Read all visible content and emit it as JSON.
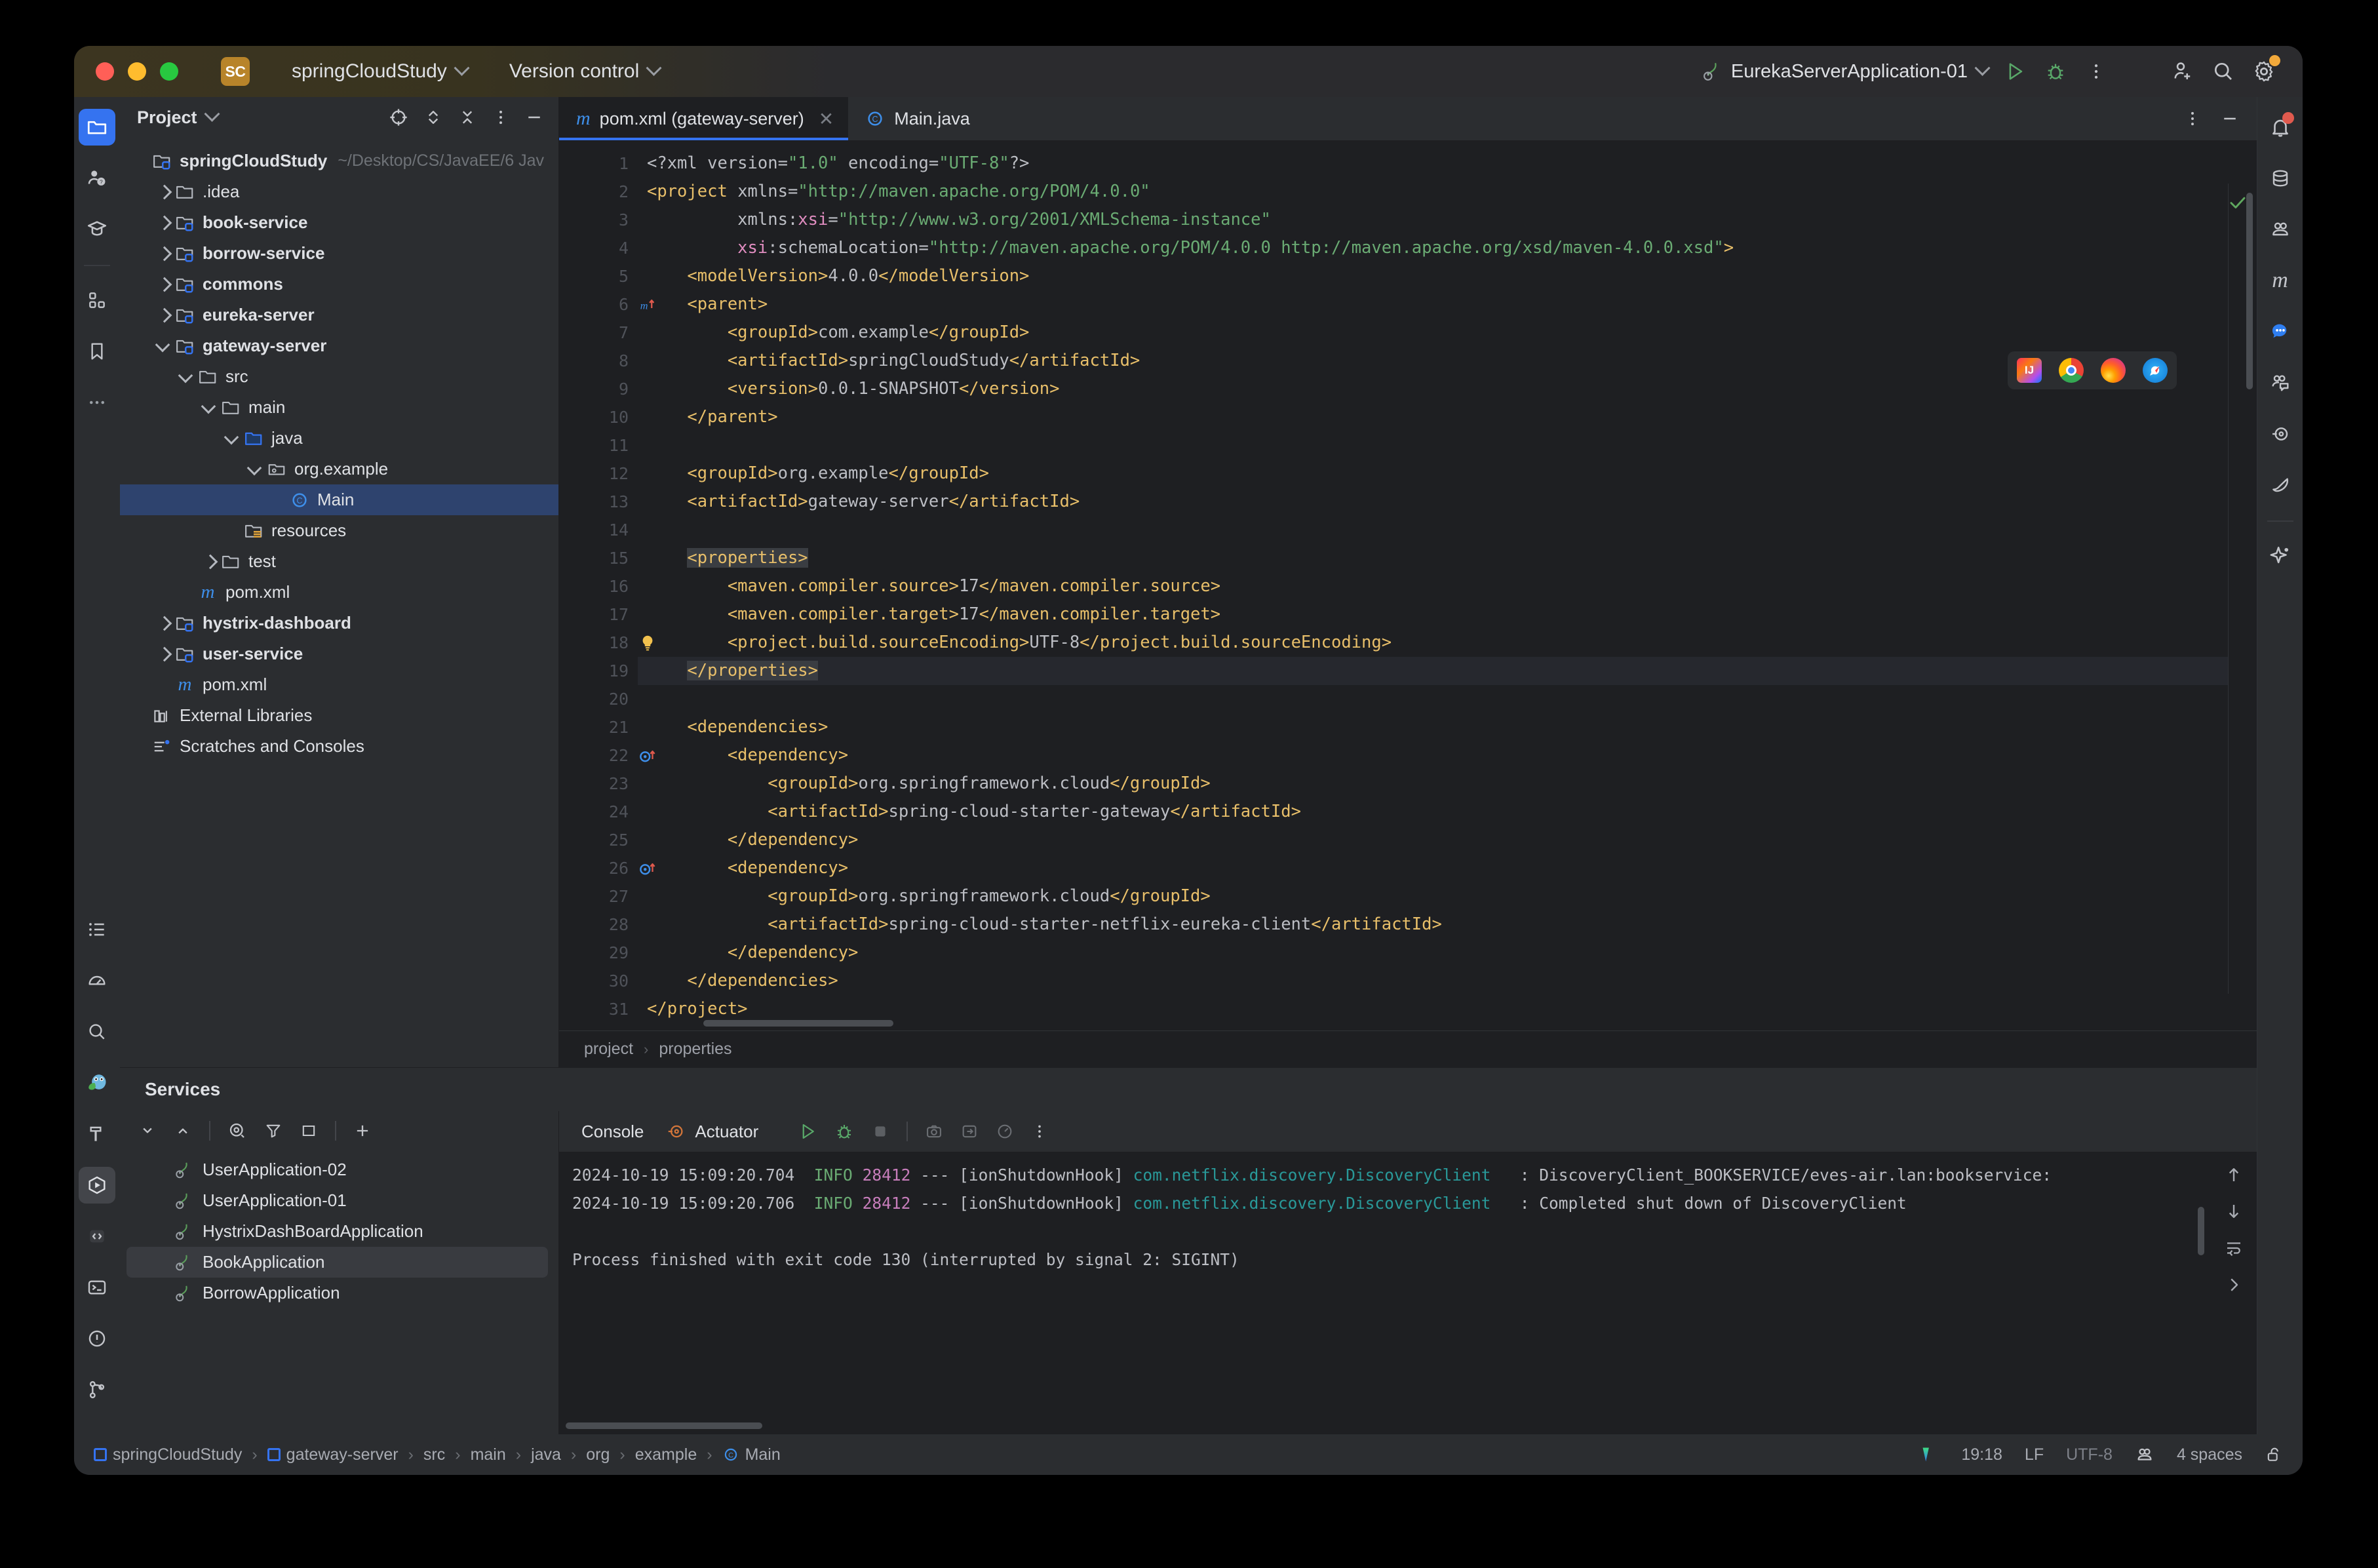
{
  "window": {
    "project_badge": "SC",
    "project_name": "springCloudStudy",
    "version_control": "Version control",
    "run_config": "EurekaServerApplication-01"
  },
  "project_panel": {
    "title": "Project",
    "tree": [
      {
        "label": "springCloudStudy",
        "sub": "~/Desktop/CS/JavaEE/6 Jav",
        "depth": 0,
        "arrow": "none",
        "icon": "module-folder",
        "bold": true,
        "selected": false
      },
      {
        "label": ".idea",
        "sub": "",
        "depth": 1,
        "arrow": "closed",
        "icon": "folder",
        "bold": false,
        "selected": false
      },
      {
        "label": "book-service",
        "sub": "",
        "depth": 1,
        "arrow": "closed",
        "icon": "module-folder",
        "bold": true,
        "selected": false
      },
      {
        "label": "borrow-service",
        "sub": "",
        "depth": 1,
        "arrow": "closed",
        "icon": "module-folder",
        "bold": true,
        "selected": false
      },
      {
        "label": "commons",
        "sub": "",
        "depth": 1,
        "arrow": "closed",
        "icon": "module-folder",
        "bold": true,
        "selected": false
      },
      {
        "label": "eureka-server",
        "sub": "",
        "depth": 1,
        "arrow": "closed",
        "icon": "module-folder",
        "bold": true,
        "selected": false
      },
      {
        "label": "gateway-server",
        "sub": "",
        "depth": 1,
        "arrow": "open",
        "icon": "module-folder",
        "bold": true,
        "selected": false
      },
      {
        "label": "src",
        "sub": "",
        "depth": 2,
        "arrow": "open",
        "icon": "folder",
        "bold": false,
        "selected": false
      },
      {
        "label": "main",
        "sub": "",
        "depth": 3,
        "arrow": "open",
        "icon": "folder",
        "bold": false,
        "selected": false
      },
      {
        "label": "java",
        "sub": "",
        "depth": 4,
        "arrow": "open",
        "icon": "source-folder",
        "bold": false,
        "selected": false
      },
      {
        "label": "org.example",
        "sub": "",
        "depth": 5,
        "arrow": "open",
        "icon": "package",
        "bold": false,
        "selected": false
      },
      {
        "label": "Main",
        "sub": "",
        "depth": 6,
        "arrow": "none",
        "icon": "java-class",
        "bold": false,
        "selected": true
      },
      {
        "label": "resources",
        "sub": "",
        "depth": 4,
        "arrow": "none",
        "icon": "resources-folder",
        "bold": false,
        "selected": false
      },
      {
        "label": "test",
        "sub": "",
        "depth": 3,
        "arrow": "closed",
        "icon": "folder",
        "bold": false,
        "selected": false
      },
      {
        "label": "pom.xml",
        "sub": "",
        "depth": 2,
        "arrow": "none",
        "icon": "maven",
        "bold": false,
        "selected": false
      },
      {
        "label": "hystrix-dashboard",
        "sub": "",
        "depth": 1,
        "arrow": "closed",
        "icon": "module-folder",
        "bold": true,
        "selected": false
      },
      {
        "label": "user-service",
        "sub": "",
        "depth": 1,
        "arrow": "closed",
        "icon": "module-folder",
        "bold": true,
        "selected": false
      },
      {
        "label": "pom.xml",
        "sub": "",
        "depth": 1,
        "arrow": "none",
        "icon": "maven",
        "bold": false,
        "selected": false
      },
      {
        "label": "External Libraries",
        "sub": "",
        "depth": 0,
        "arrow": "none",
        "icon": "libraries",
        "bold": false,
        "selected": false
      },
      {
        "label": "Scratches and Consoles",
        "sub": "",
        "depth": 0,
        "arrow": "none",
        "icon": "scratches",
        "bold": false,
        "selected": false
      }
    ]
  },
  "editor": {
    "tabs": [
      {
        "label": "pom.xml (gateway-server)",
        "icon": "maven-icon",
        "active": true,
        "closable": true
      },
      {
        "label": "Main.java",
        "icon": "java-class-icon",
        "active": false,
        "closable": false
      }
    ],
    "breadcrumb": [
      "project",
      "properties"
    ],
    "current_line": 19,
    "lines": [
      {
        "n": 1,
        "mark": "",
        "cur": false,
        "html": "<span class='pi'>&lt;?xml version=</span><span class='str'>\"1.0\"</span><span class='pi'> encoding=</span><span class='str'>\"UTF-8\"</span><span class='pi'>?&gt;</span>"
      },
      {
        "n": 2,
        "mark": "",
        "cur": false,
        "html": "<span class='tag'>&lt;project</span> <span class='attr'>xmlns=</span><span class='str'>\"http://maven.apache.org/POM/4.0.0\"</span>"
      },
      {
        "n": 3,
        "mark": "",
        "cur": false,
        "html": "         <span class='attr'>xmlns:</span><span class='attrns'>xsi</span><span class='attr'>=</span><span class='str'>\"http://www.w3.org/2001/XMLSchema-instance\"</span>"
      },
      {
        "n": 4,
        "mark": "",
        "cur": false,
        "html": "         <span class='attrns'>xsi</span><span class='attr'>:schemaLocation=</span><span class='str'>\"http://maven.apache.org/POM/4.0.0 http://maven.apache.org/xsd/maven-4.0.0.xsd\"</span><span class='tag'>&gt;</span>"
      },
      {
        "n": 5,
        "mark": "",
        "cur": false,
        "html": "    <span class='tag'>&lt;modelVersion&gt;</span><span class='txt'>4.0.0</span><span class='tag'>&lt;/modelVersion&gt;</span>"
      },
      {
        "n": 6,
        "mark": "maven-parent",
        "cur": false,
        "html": "    <span class='tag'>&lt;parent&gt;</span>"
      },
      {
        "n": 7,
        "mark": "",
        "cur": false,
        "html": "        <span class='tag'>&lt;groupId&gt;</span><span class='txt'>com.example</span><span class='tag'>&lt;/groupId&gt;</span>"
      },
      {
        "n": 8,
        "mark": "",
        "cur": false,
        "html": "        <span class='tag'>&lt;artifactId&gt;</span><span class='txt'>springCloudStudy</span><span class='tag'>&lt;/artifactId&gt;</span>"
      },
      {
        "n": 9,
        "mark": "",
        "cur": false,
        "html": "        <span class='tag'>&lt;version&gt;</span><span class='txt'>0.0.1-SNAPSHOT</span><span class='tag'>&lt;/version&gt;</span>"
      },
      {
        "n": 10,
        "mark": "",
        "cur": false,
        "html": "    <span class='tag'>&lt;/parent&gt;</span>"
      },
      {
        "n": 11,
        "mark": "",
        "cur": false,
        "html": ""
      },
      {
        "n": 12,
        "mark": "",
        "cur": false,
        "html": "    <span class='tag'>&lt;groupId&gt;</span><span class='txt'>org.example</span><span class='tag'>&lt;/groupId&gt;</span>"
      },
      {
        "n": 13,
        "mark": "",
        "cur": false,
        "html": "    <span class='tag'>&lt;artifactId&gt;</span><span class='txt'>gateway-server</span><span class='tag'>&lt;/artifactId&gt;</span>"
      },
      {
        "n": 14,
        "mark": "",
        "cur": false,
        "html": ""
      },
      {
        "n": 15,
        "mark": "",
        "cur": false,
        "html": "    <span class='tag hl'>&lt;properties&gt;</span>"
      },
      {
        "n": 16,
        "mark": "",
        "cur": false,
        "html": "        <span class='tag'>&lt;maven.compiler.source&gt;</span><span class='txt'>17</span><span class='tag'>&lt;/maven.compiler.source&gt;</span>"
      },
      {
        "n": 17,
        "mark": "",
        "cur": false,
        "html": "        <span class='tag'>&lt;maven.compiler.target&gt;</span><span class='txt'>17</span><span class='tag'>&lt;/maven.compiler.target&gt;</span>"
      },
      {
        "n": 18,
        "mark": "bulb",
        "cur": false,
        "html": "        <span class='tag'>&lt;project.build.sourceEncoding&gt;</span><span class='txt'>UTF-8</span><span class='tag'>&lt;/project.build.sourceEncoding&gt;</span>"
      },
      {
        "n": 19,
        "mark": "",
        "cur": true,
        "html": "    <span class='tag hl'>&lt;/properties&gt;</span>"
      },
      {
        "n": 20,
        "mark": "",
        "cur": false,
        "html": ""
      },
      {
        "n": 21,
        "mark": "",
        "cur": false,
        "html": "    <span class='tag'>&lt;dependencies&gt;</span>"
      },
      {
        "n": 22,
        "mark": "maven-dep",
        "cur": false,
        "html": "        <span class='tag'>&lt;dependency&gt;</span>"
      },
      {
        "n": 23,
        "mark": "",
        "cur": false,
        "html": "            <span class='tag'>&lt;groupId&gt;</span><span class='txt'>org.springframework.cloud</span><span class='tag'>&lt;/groupId&gt;</span>"
      },
      {
        "n": 24,
        "mark": "",
        "cur": false,
        "html": "            <span class='tag'>&lt;artifactId&gt;</span><span class='txt'>spring-cloud-starter-gateway</span><span class='tag'>&lt;/artifactId&gt;</span>"
      },
      {
        "n": 25,
        "mark": "",
        "cur": false,
        "html": "        <span class='tag'>&lt;/dependency&gt;</span>"
      },
      {
        "n": 26,
        "mark": "maven-dep",
        "cur": false,
        "html": "        <span class='tag'>&lt;dependency&gt;</span>"
      },
      {
        "n": 27,
        "mark": "",
        "cur": false,
        "html": "            <span class='tag'>&lt;groupId&gt;</span><span class='txt'>org.springframework.cloud</span><span class='tag'>&lt;/groupId&gt;</span>"
      },
      {
        "n": 28,
        "mark": "",
        "cur": false,
        "html": "            <span class='tag'>&lt;artifactId&gt;</span><span class='txt'>spring-cloud-starter-netflix-eureka-client</span><span class='tag'>&lt;/artifactId&gt;</span>"
      },
      {
        "n": 29,
        "mark": "",
        "cur": false,
        "html": "        <span class='tag'>&lt;/dependency&gt;</span>"
      },
      {
        "n": 30,
        "mark": "",
        "cur": false,
        "html": "    <span class='tag'>&lt;/dependencies&gt;</span>"
      },
      {
        "n": 31,
        "mark": "",
        "cur": false,
        "html": "<span class='tag'>&lt;/project&gt;</span>"
      }
    ]
  },
  "services": {
    "title": "Services",
    "items": [
      {
        "label": "UserApplication-02",
        "selected": false
      },
      {
        "label": "UserApplication-01",
        "selected": false
      },
      {
        "label": "HystrixDashBoardApplication",
        "selected": false
      },
      {
        "label": "BookApplication",
        "selected": true
      },
      {
        "label": "BorrowApplication",
        "selected": false
      }
    ],
    "console_tabs": [
      {
        "label": "Console",
        "icon": "none"
      },
      {
        "label": "Actuator",
        "icon": "actuator-icon"
      }
    ],
    "console_lines": [
      {
        "ts": "2024-10-19 15:09:20.704",
        "level": "INFO",
        "pid": "28412",
        "dash": "---",
        "thread": "[ionShutdownHook]",
        "cls": "com.netflix.discovery.DiscoveryClient",
        "msg": ": DiscoveryClient_BOOKSERVICE/eves-air.lan:bookservice:"
      },
      {
        "ts": "2024-10-19 15:09:20.706",
        "level": "INFO",
        "pid": "28412",
        "dash": "---",
        "thread": "[ionShutdownHook]",
        "cls": "com.netflix.discovery.DiscoveryClient",
        "msg": ": Completed shut down of DiscoveryClient"
      }
    ],
    "console_exit": "Process finished with exit code 130 (interrupted by signal 2: SIGINT)"
  },
  "status_bar": {
    "crumbs": [
      "springCloudStudy",
      "gateway-server",
      "src",
      "main",
      "java",
      "org",
      "example",
      "Main"
    ],
    "caret": "19:18",
    "line_sep": "LF",
    "encoding": "UTF-8",
    "indent": "4 spaces"
  },
  "colors": {
    "accent": "#3573f0",
    "tag": "#e8bf6a",
    "string": "#6aab73",
    "class_ref": "#299999",
    "pid": "#c77dbb",
    "badge": "#b8842a"
  }
}
